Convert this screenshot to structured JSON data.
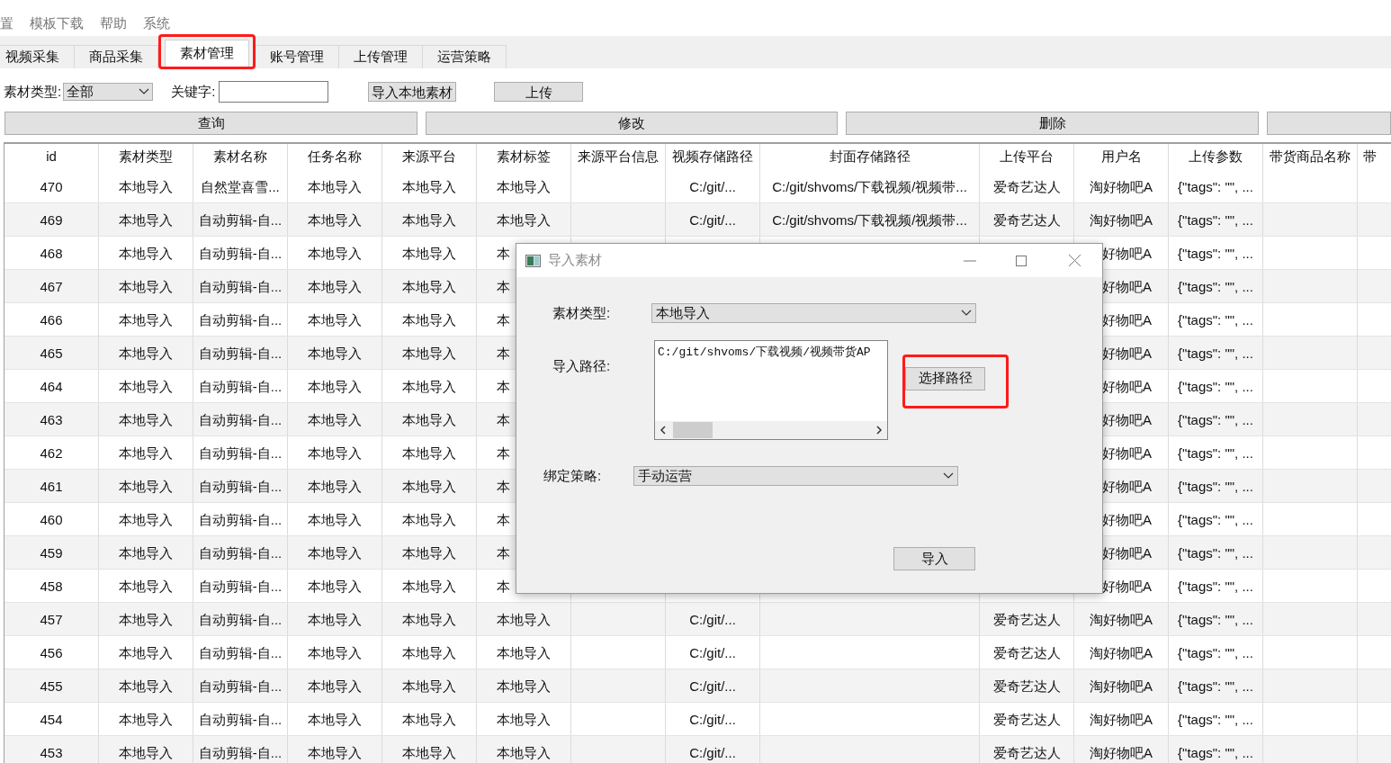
{
  "menu": [
    "置",
    "模板下载",
    "帮助",
    "系统"
  ],
  "tabs": [
    {
      "label": "视频采集",
      "selected": false,
      "highlighted": false
    },
    {
      "label": "商品采集",
      "selected": false,
      "highlighted": false
    },
    {
      "label": "素材管理",
      "selected": true,
      "highlighted": true
    },
    {
      "label": "账号管理",
      "selected": false,
      "highlighted": false
    },
    {
      "label": "上传管理",
      "selected": false,
      "highlighted": false
    },
    {
      "label": "运营策略",
      "selected": false,
      "highlighted": false
    }
  ],
  "filter": {
    "type_label": "素材类型:",
    "type_value": "全部",
    "keyword_label": "关键字:",
    "buttons": [
      "导入本地素材",
      "上传"
    ]
  },
  "actions": [
    "查询",
    "修改",
    "删除"
  ],
  "table": {
    "columns": [
      "id",
      "素材类型",
      "素材名称",
      "任务名称",
      "来源平台",
      "素材标签",
      "来源平台信息",
      "视频存储路径",
      "封面存储路径",
      "上传平台",
      "用户名",
      "上传参数",
      "带货商品名称",
      "带"
    ],
    "rows": [
      {
        "kind": "full",
        "cells": [
          "470",
          "本地导入",
          "自然堂喜雪...",
          "本地导入",
          "本地导入",
          "本地导入",
          null,
          "C:/git/...",
          "C:/git/shvoms/下载视频/视频带...",
          "爱奇艺达人",
          "淘好物吧A",
          "{\"tags\": \"\", ...",
          null,
          null
        ]
      },
      {
        "kind": "full",
        "cells": [
          "469",
          "本地导入",
          "自动剪辑-自...",
          "本地导入",
          "本地导入",
          "本地导入",
          null,
          "C:/git/...",
          "C:/git/shvoms/下载视频/视频带...",
          "爱奇艺达人",
          "淘好物吧A",
          "{\"tags\": \"\", ...",
          null,
          null
        ]
      },
      {
        "kind": "covered",
        "cells": [
          "468",
          "本地导入",
          "自动剪辑-自...",
          "本地导入",
          "本地导入",
          "本",
          null,
          null,
          null,
          null,
          "好物吧A",
          "{\"tags\": \"\", ...",
          null,
          null
        ]
      },
      {
        "kind": "covered",
        "cells": [
          "467",
          "本地导入",
          "自动剪辑-自...",
          "本地导入",
          "本地导入",
          "本",
          null,
          null,
          null,
          null,
          "好物吧A",
          "{\"tags\": \"\", ...",
          null,
          null
        ]
      },
      {
        "kind": "covered",
        "cells": [
          "466",
          "本地导入",
          "自动剪辑-自...",
          "本地导入",
          "本地导入",
          "本",
          null,
          null,
          null,
          null,
          "好物吧A",
          "{\"tags\": \"\", ...",
          null,
          null
        ]
      },
      {
        "kind": "covered",
        "cells": [
          "465",
          "本地导入",
          "自动剪辑-自...",
          "本地导入",
          "本地导入",
          "本",
          null,
          null,
          null,
          null,
          "好物吧A",
          "{\"tags\": \"\", ...",
          null,
          null
        ]
      },
      {
        "kind": "covered",
        "cells": [
          "464",
          "本地导入",
          "自动剪辑-自...",
          "本地导入",
          "本地导入",
          "本",
          null,
          null,
          null,
          null,
          "好物吧A",
          "{\"tags\": \"\", ...",
          null,
          null
        ]
      },
      {
        "kind": "covered",
        "cells": [
          "463",
          "本地导入",
          "自动剪辑-自...",
          "本地导入",
          "本地导入",
          "本",
          null,
          null,
          null,
          null,
          "好物吧A",
          "{\"tags\": \"\", ...",
          null,
          null
        ]
      },
      {
        "kind": "covered",
        "cells": [
          "462",
          "本地导入",
          "自动剪辑-自...",
          "本地导入",
          "本地导入",
          "本",
          null,
          null,
          null,
          null,
          "好物吧A",
          "{\"tags\": \"\", ...",
          null,
          null
        ]
      },
      {
        "kind": "covered",
        "cells": [
          "461",
          "本地导入",
          "自动剪辑-自...",
          "本地导入",
          "本地导入",
          "本",
          null,
          null,
          null,
          null,
          "好物吧A",
          "{\"tags\": \"\", ...",
          null,
          null
        ]
      },
      {
        "kind": "covered",
        "cells": [
          "460",
          "本地导入",
          "自动剪辑-自...",
          "本地导入",
          "本地导入",
          "本",
          null,
          null,
          null,
          null,
          "好物吧A",
          "{\"tags\": \"\", ...",
          null,
          null
        ]
      },
      {
        "kind": "covered",
        "cells": [
          "459",
          "本地导入",
          "自动剪辑-自...",
          "本地导入",
          "本地导入",
          "本",
          null,
          null,
          null,
          null,
          "好物吧A",
          "{\"tags\": \"\", ...",
          null,
          null
        ]
      },
      {
        "kind": "covered",
        "cells": [
          "458",
          "本地导入",
          "自动剪辑-自...",
          "本地导入",
          "本地导入",
          "本",
          null,
          null,
          null,
          null,
          "好物吧A",
          "{\"tags\": \"\", ...",
          null,
          null
        ]
      },
      {
        "kind": "full",
        "cells": [
          "457",
          "本地导入",
          "自动剪辑-自...",
          "本地导入",
          "本地导入",
          "本地导入",
          null,
          "C:/git/...",
          null,
          "爱奇艺达人",
          "淘好物吧A",
          "{\"tags\": \"\", ...",
          null,
          null
        ]
      },
      {
        "kind": "full",
        "cells": [
          "456",
          "本地导入",
          "自动剪辑-自...",
          "本地导入",
          "本地导入",
          "本地导入",
          null,
          "C:/git/...",
          null,
          "爱奇艺达人",
          "淘好物吧A",
          "{\"tags\": \"\", ...",
          null,
          null
        ]
      },
      {
        "kind": "full",
        "cells": [
          "455",
          "本地导入",
          "自动剪辑-自...",
          "本地导入",
          "本地导入",
          "本地导入",
          null,
          "C:/git/...",
          null,
          "爱奇艺达人",
          "淘好物吧A",
          "{\"tags\": \"\", ...",
          null,
          null
        ]
      },
      {
        "kind": "full",
        "cells": [
          "454",
          "本地导入",
          "自动剪辑-自...",
          "本地导入",
          "本地导入",
          "本地导入",
          null,
          "C:/git/...",
          null,
          "爱奇艺达人",
          "淘好物吧A",
          "{\"tags\": \"\", ...",
          null,
          null
        ]
      },
      {
        "kind": "full",
        "cells": [
          "453",
          "本地导入",
          "自动剪辑-自...",
          "本地导入",
          "本地导入",
          "本地导入",
          null,
          "C:/git/...",
          null,
          "爱奇艺达人",
          "淘好物吧A",
          "{\"tags\": \"\", ...",
          null,
          null
        ]
      }
    ]
  },
  "dialog": {
    "title": "导入素材",
    "type_label": "素材类型:",
    "type_value": "本地导入",
    "path_label": "导入路径:",
    "path_value": "C:/git/shvoms/下载视频/视频带货AP",
    "choose_button": {
      "label": "选择路径",
      "highlighted": true
    },
    "strategy_label": "绑定策略:",
    "strategy_value": "手动运营",
    "import_button": "导入"
  }
}
